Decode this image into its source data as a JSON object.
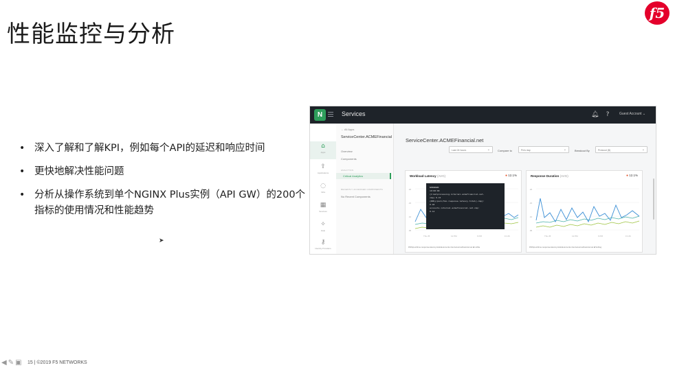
{
  "slide": {
    "title": "性能监控与分析",
    "logo_text": "f5",
    "bullets": [
      "深入了解和了解KPI，例如每个API的延迟和响应时间",
      "更快地解决性能问题",
      "分析从操作系统到单个NGINX Plus实例（API GW）的200个指标的使用情况和性能趋势"
    ],
    "footer": "15 | ©2019 F5 NETWORKS"
  },
  "app": {
    "logo": "N",
    "title": "Services",
    "account": "Guest Account ⌄",
    "icons": [
      "bell-icon",
      "help-icon",
      "gear-icon"
    ],
    "rail": [
      {
        "icon": "home-icon",
        "label": "Apps"
      },
      {
        "icon": "rocket-icon",
        "label": "Applications"
      },
      {
        "icon": "bulb-icon",
        "label": "Infra"
      },
      {
        "icon": "grid-icon",
        "label": "Services"
      },
      {
        "icon": "star-icon",
        "label": "Help"
      },
      {
        "icon": "key-icon",
        "label": "Identity Providers"
      }
    ],
    "nav": {
      "back": "← All Apps",
      "header": "ServiceCenter.ACMEFinancial",
      "items": [
        "Overview",
        "Components"
      ],
      "section_analytics": "ANALYTICS",
      "selected": "Critical Analytics",
      "section_recent": "RECENTLY ACCESSED COMPONENTS",
      "recent_item": "No Recent Components"
    },
    "main": {
      "title": "ServiceCenter.ACMEFinancial.net",
      "time_range": "Last 24 hours",
      "compare_label": "Compare to",
      "compare_value": "Prev day",
      "breakout_label": "Breakout By",
      "breakout_value": "Protocol ($)"
    },
    "cards": [
      {
        "title": "Workload Latency",
        "unit": "(AVG)",
        "badge": "12.1%",
        "legend": "DNS/pool/timo-response-latency.total ■  accounts.internal.acmefinancial.net ■  ListSa"
      },
      {
        "title": "Response Duration",
        "unit": "(AVG)",
        "badge": "12.1%",
        "legend": "DNS/pool/timo-response-latency.total ■  accounts.internal.acmefinancial.net ■  Sublog"
      }
    ],
    "tooltip": {
      "date": "6/29/2020",
      "time": "10:00:00",
      "lines": [
        "{1:metprocessing.internal.acmefinancial.net-",
        "  cmp} 0.15",
        "{DNS}/pool/tmo.response.latency.total{-cmp}:",
        "  0.18",
        "accounts.internal.acmefinancial.net-cmp:",
        "  0.14"
      ]
    }
  },
  "colors": {
    "f5_red": "#e4002b",
    "nginx_green": "#2e9e5b",
    "series_blue": "#3b8fd6",
    "series_green": "#9cc23d",
    "series_teal": "#48b0a8"
  }
}
